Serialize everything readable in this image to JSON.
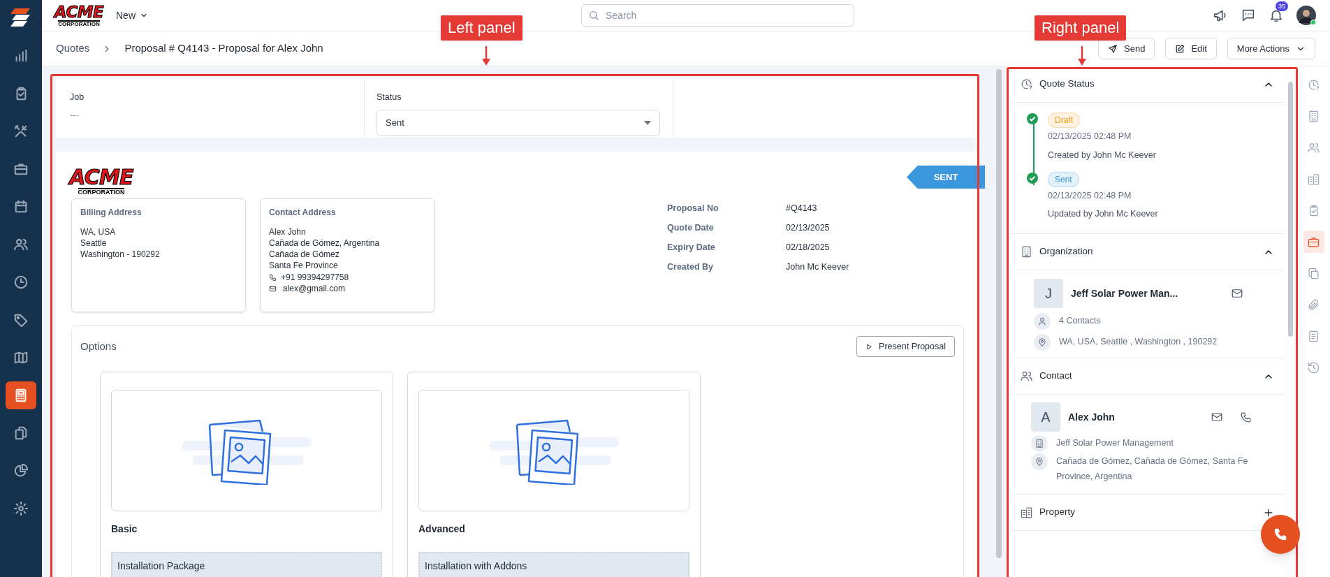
{
  "annotations": [
    {
      "label": "Left panel"
    },
    {
      "label": "Right panel"
    }
  ],
  "sidebar": {
    "items": [
      {
        "selected": false
      },
      {
        "selected": false
      },
      {
        "selected": false
      },
      {
        "selected": false
      },
      {
        "selected": false
      },
      {
        "selected": false
      },
      {
        "selected": false
      },
      {
        "selected": false
      },
      {
        "selected": false
      },
      {
        "selected": true
      },
      {
        "selected": false
      },
      {
        "selected": false
      },
      {
        "selected": false
      }
    ]
  },
  "top_bar": {
    "logo": {
      "name": "ACME",
      "sub": "CORPORATION"
    },
    "new_menu": "New",
    "search": {
      "placeholder": "Search"
    },
    "notification_count": "35"
  },
  "breadcrumb": {
    "parent": "Quotes",
    "title": "Proposal # Q4143 - Proposal for Alex John"
  },
  "actions": [
    {
      "kind": "send",
      "label": "Send"
    },
    {
      "kind": "edit",
      "label": "Edit"
    },
    {
      "kind": "menu",
      "label": "More Actions"
    }
  ],
  "job": {
    "label": "Job",
    "value": "---"
  },
  "status_field": {
    "label": "Status",
    "value": "Sent"
  },
  "quote": {
    "logo": {
      "name": "ACME",
      "sub": "CORPORATION"
    },
    "ribbon": "SENT",
    "billing": {
      "title": "Billing Address",
      "lines": [
        "WA, USA",
        "Seattle",
        "Washington - 190292"
      ]
    },
    "contact": {
      "title": "Contact Address",
      "lines": [
        "Alex John",
        "Cañada de Gómez, Argentina",
        "Cañada de Gómez",
        "Santa Fe Province"
      ],
      "phone": "+91 99394297758",
      "email": "alex@gmail.com"
    },
    "meta": [
      {
        "label": "Proposal No",
        "value": "#Q4143"
      },
      {
        "label": "Quote Date",
        "value": "02/13/2025"
      },
      {
        "label": "Expiry Date",
        "value": "02/18/2025"
      },
      {
        "label": "Created By",
        "value": "John Mc Keever"
      }
    ]
  },
  "options": {
    "title": "Options",
    "button": "Present Proposal",
    "items": [
      {
        "name": "Basic",
        "package": "Installation Package"
      },
      {
        "name": "Advanced",
        "package": "Installation with Addons"
      }
    ]
  },
  "right_panel": {
    "quote_status": {
      "title": "Quote Status",
      "expanded": true,
      "steps": [
        {
          "badge": "Draft",
          "color": "#f29a1c",
          "time": "02/13/2025 02:48 PM",
          "by": "Created by John Mc Keever"
        },
        {
          "badge": "Sent",
          "color": "#3a96dd",
          "time": "02/13/2025 02:48 PM",
          "by": "Updated by John Mc Keever"
        }
      ]
    },
    "organization": {
      "title": "Organization",
      "expanded": true,
      "initial": "J",
      "name": "Jeff Solar Power Man...",
      "contacts": "4 Contacts",
      "address": "WA, USA, Seattle , Washington , 190292"
    },
    "contact": {
      "title": "Contact",
      "expanded": true,
      "initial": "A",
      "name": "Alex John",
      "organization": "Jeff Solar Power Management",
      "address": "Cañada de Gómez, Cañada de Gómez, Santa Fe Province, Argentina"
    },
    "property": {
      "title": "Property"
    }
  },
  "rail": {
    "items": [
      {
        "selected": false
      },
      {
        "selected": false
      },
      {
        "selected": false
      },
      {
        "selected": false
      },
      {
        "selected": false
      },
      {
        "selected": true
      },
      {
        "selected": false
      },
      {
        "selected": false
      },
      {
        "selected": false
      },
      {
        "selected": false
      }
    ]
  }
}
